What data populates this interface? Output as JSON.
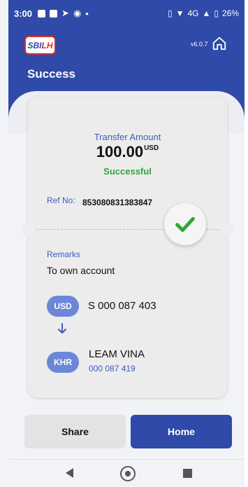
{
  "status_bar": {
    "time": "3:00",
    "network": "4G",
    "battery": "26%"
  },
  "header": {
    "logo_text_left": "SBI",
    "logo_text_right": "LH",
    "version": "v6.0.7",
    "title": "Success"
  },
  "receipt": {
    "amount_label": "Transfer Amount",
    "amount": "100.00",
    "currency": "USD",
    "status": "Successful",
    "ref_label": "Ref No:",
    "ref_value": "853080831383847",
    "remarks_label": "Remarks",
    "remarks_value": "To own account",
    "from": {
      "currency": "USD",
      "account": "S 000 087 403"
    },
    "to": {
      "currency": "KHR",
      "name": "LEAM VINA",
      "account": "000 087 419"
    }
  },
  "actions": {
    "share_label": "Share",
    "home_label": "Home"
  },
  "colors": {
    "brand_blue": "#2f4aa8",
    "success_green": "#2fa53a",
    "pill_blue": "#6c86d8"
  },
  "icons": [
    "home-icon",
    "check-icon",
    "arrow-down-icon",
    "back-icon",
    "home-nav-icon",
    "recents-icon"
  ]
}
